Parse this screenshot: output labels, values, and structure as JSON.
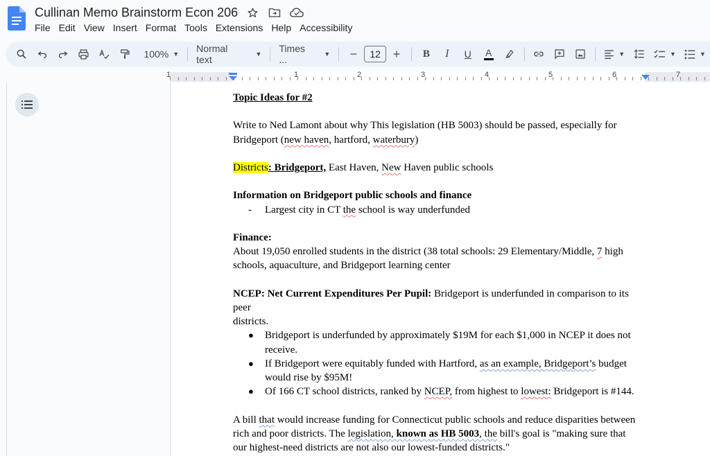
{
  "header": {
    "doc_title": "Cullinan Memo Brainstorm Econ 206",
    "menu": [
      "File",
      "Edit",
      "View",
      "Insert",
      "Format",
      "Tools",
      "Extensions",
      "Help",
      "Accessibility"
    ]
  },
  "toolbar": {
    "zoom": "100%",
    "style": "Normal text",
    "font": "Times ...",
    "font_size": "12",
    "bold": "B",
    "italic": "I",
    "underline": "U",
    "text_color": "A"
  },
  "ruler": {
    "numbers": [
      "1",
      "1",
      "2",
      "3",
      "4",
      "5",
      "6",
      "7"
    ]
  },
  "document": {
    "heading": "Topic Ideas for #2",
    "p1_a": "Write to Ned Lamont about why This legislation (HB 5003) should be passed, especially for",
    "p1_b_1": "Bridgeport (",
    "p1_b_2": "new haven",
    "p1_b_3": ", hartford, ",
    "p1_b_4": "waterbury",
    "p1_b_5": ")",
    "districts_label": "Districts",
    "districts_colon": ": ",
    "districts_bp": "Bridgeport,",
    "districts_rest_1": " East Haven, ",
    "districts_new": "New",
    "districts_rest_2": " Haven public schools",
    "info_heading": "Information on Bridgeport public schools and finance",
    "info_dash": "-",
    "info_item_1": "Largest city in CT ",
    "info_item_the": "the",
    "info_item_2": " school is way underfunded",
    "finance_heading": "Finance:",
    "finance_1a": "About 19,050 enrolled students in the district (38 total schools: 29 Elementary/Middle, ",
    "finance_1b": "7",
    "finance_1c": " high",
    "finance_2": "schools, aquaculture, and Bridgeport learning center",
    "ncep_bold": "NCEP: Net Current Expenditures Per Pupil:",
    "ncep_text": " Bridgeport is underfunded in comparison to its",
    "ncep_peer": "peer",
    "ncep_districts": "districts.",
    "bullet_1": "Bridgeport is underfunded by approximately $19M for each $1,000 in NCEP it does not receive.",
    "bullet_2a": "If Bridgeport were equitably funded with Hartford, ",
    "bullet_2b": "as an example, Bridgeport’s",
    "bullet_2c": " budget would rise by $95M!",
    "bullet_3a": "Of 166 CT school districts, ranked by ",
    "bullet_3b": "NCEP,",
    "bullet_3c": " from highest to ",
    "bullet_3d": "lowest:",
    "bullet_3e": " Bridgeport is #144.",
    "bill_1a": "A bill ",
    "bill_1b": "that",
    "bill_1c": " would increase funding for Connecticut public schools and reduce disparities between",
    "bill_2a": "rich and poor districts. The ",
    "bill_2b": "legislation, ",
    "bill_2c": "known as HB 5003",
    "bill_2d": ", the",
    "bill_2e": " bill's goal is \"making sure that",
    "bill_3": "our highest-need districts are not also our lowest-funded districts.\""
  }
}
